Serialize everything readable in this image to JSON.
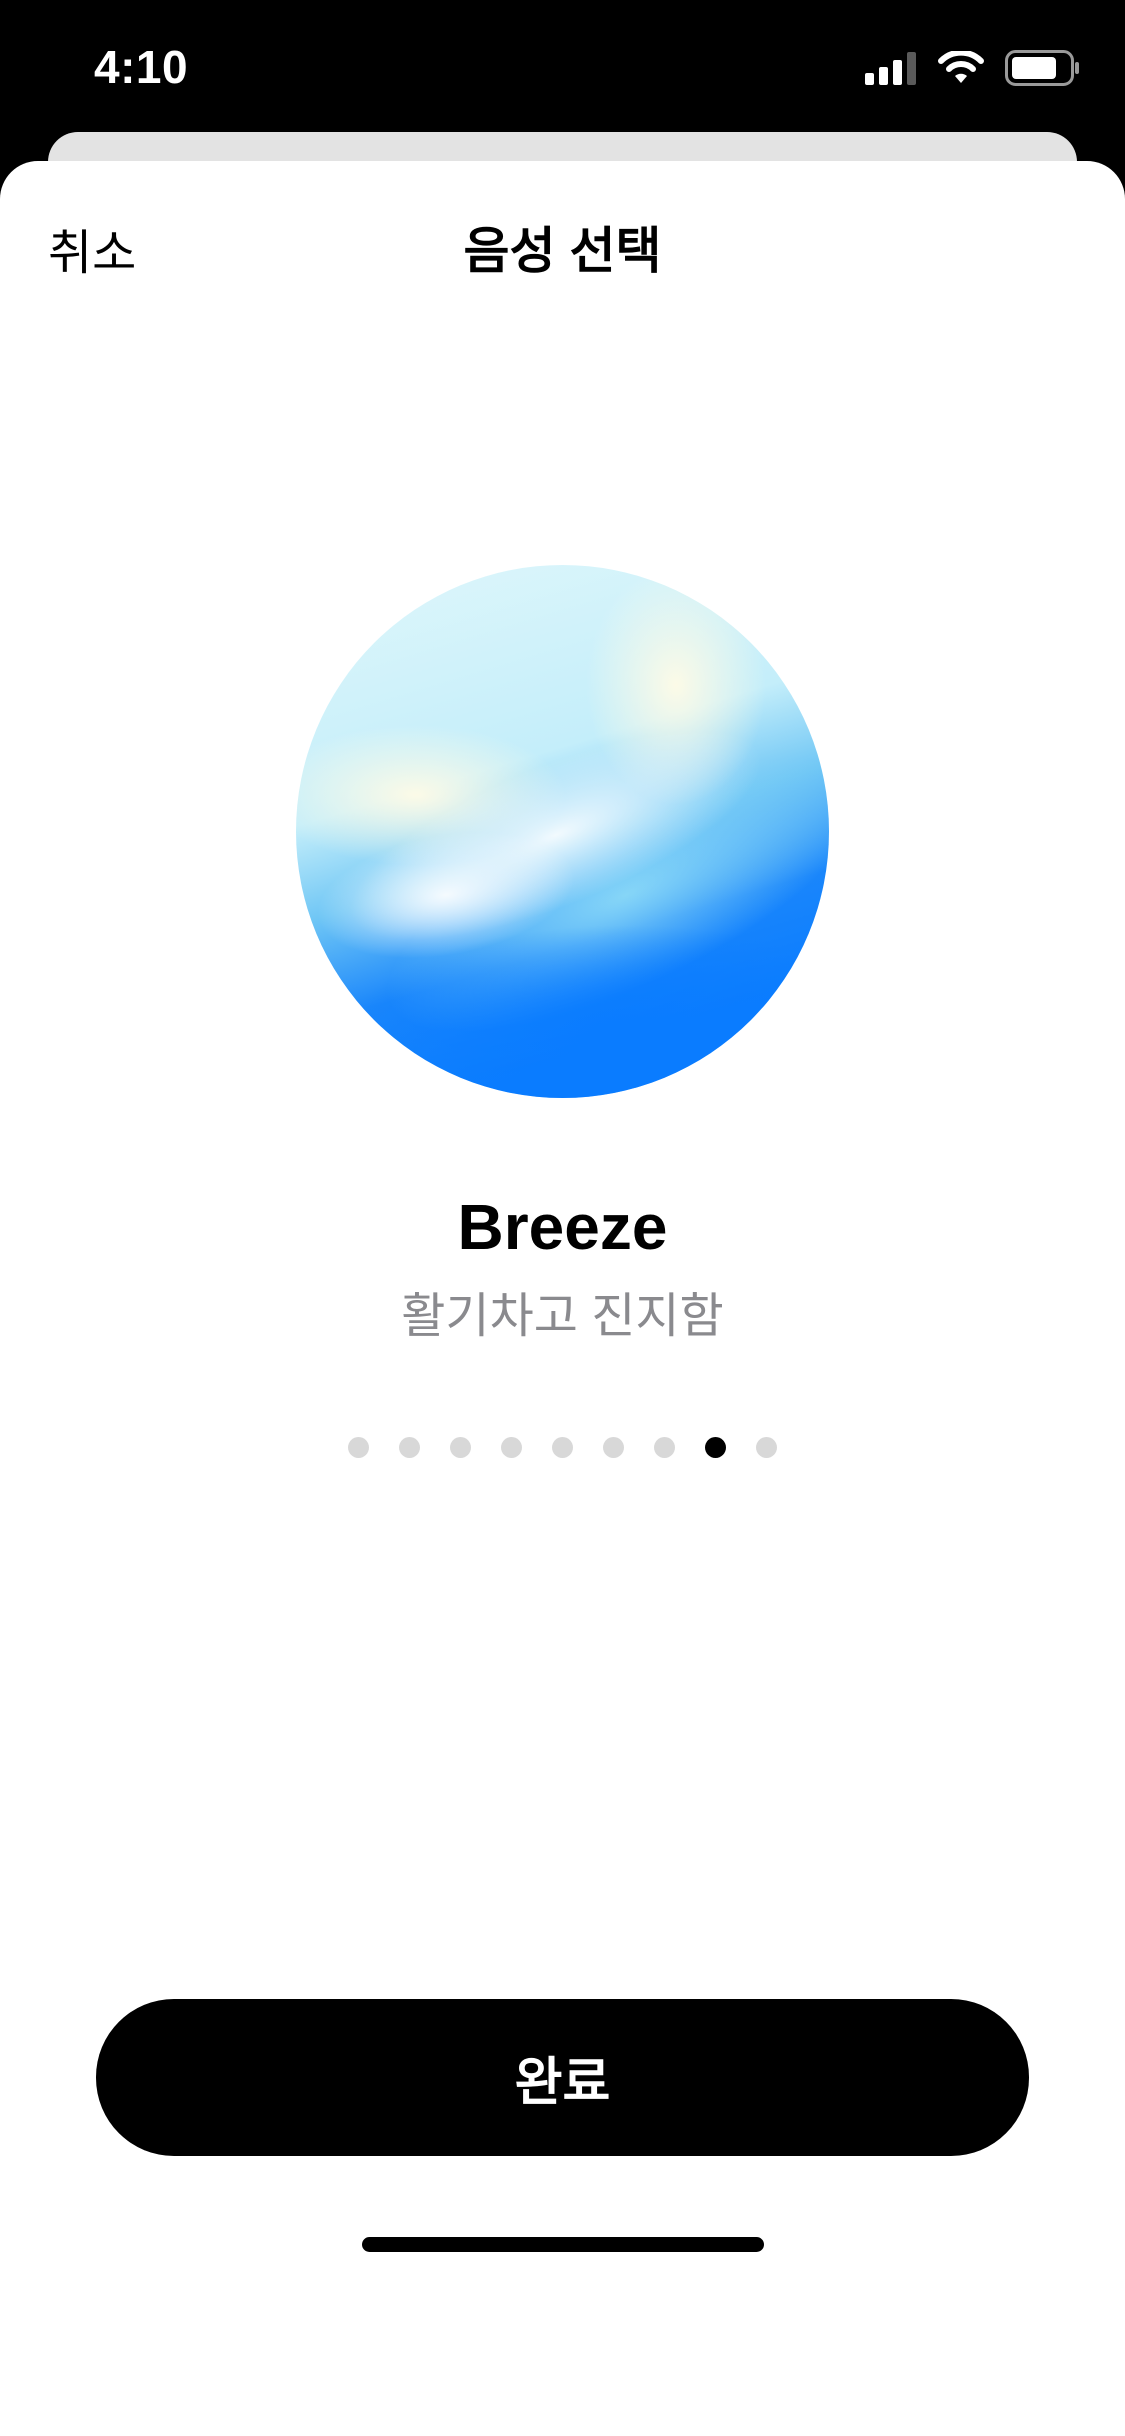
{
  "status_bar": {
    "time": "4:10",
    "icons": [
      "signal-icon",
      "wifi-icon",
      "battery-icon"
    ]
  },
  "nav": {
    "cancel_label": "취소",
    "title": "음성 선택"
  },
  "voice": {
    "name": "Breeze",
    "description": "활기차고 진지함",
    "orb_colors": [
      "#e0f7fb",
      "#fffbe6",
      "#8fdcf7",
      "#0a7cff"
    ]
  },
  "pager": {
    "count": 9,
    "active_index": 7
  },
  "actions": {
    "done_label": "완료"
  },
  "colors": {
    "accent": "#000000",
    "secondary_text": "#8a8a8e",
    "dot_inactive": "#d8d8d8"
  }
}
